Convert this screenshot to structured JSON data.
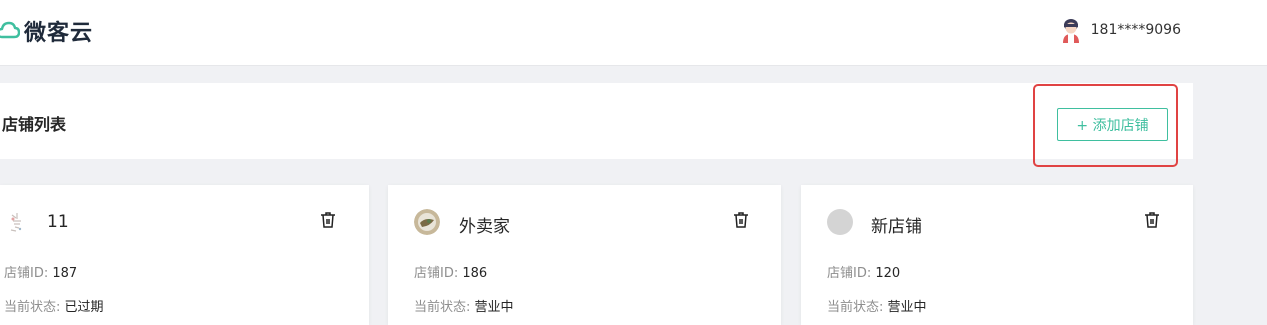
{
  "header": {
    "brand": "微客云",
    "user_phone": "181****9096",
    "accent_color": "#3fbf9f"
  },
  "shop_list": {
    "title": "店铺列表",
    "add_button_label": "+ 添加店铺"
  },
  "cards": [
    {
      "name": "11",
      "id_label": "店铺ID:",
      "id_value": "187",
      "status_label": "当前状态:",
      "status_value": "已过期",
      "avatar": "sketch-image"
    },
    {
      "name": "外卖家",
      "id_label": "店铺ID:",
      "id_value": "186",
      "status_label": "当前状态:",
      "status_value": "营业中",
      "avatar": "photo-image"
    },
    {
      "name": "新店铺",
      "id_label": "店铺ID:",
      "id_value": "120",
      "status_label": "当前状态:",
      "status_value": "营业中",
      "avatar": "placeholder-circle"
    }
  ]
}
